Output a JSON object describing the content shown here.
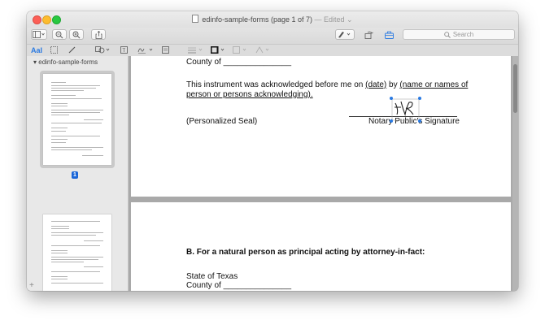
{
  "window": {
    "title": "edinfo-sample-forms (page 1 of 7)",
    "edited": "— Edited ⌄"
  },
  "toolbar": {
    "search_placeholder": "Search"
  },
  "markup": {
    "text_tool": "AaI"
  },
  "sidebar": {
    "title": "edinfo-sample-forms",
    "current_page_badge": "1"
  },
  "document": {
    "county_line_1": "County of _______________",
    "ack_line_1_pre": "This instrument was acknowledged before me on ",
    "ack_date": "(date)",
    "ack_by": " by ",
    "ack_name": "(name or names of",
    "ack_line_2": "person or persons acknowledging).",
    "seal": "(Personalized Seal)",
    "notary_signature": "Notary Public's Signature",
    "section_b_heading": "B. For a natural person as principal acting by attorney-in-fact:",
    "state_line": "State of Texas",
    "county_line_2": "County of _______________"
  },
  "colors": {
    "accent": "#2a7ae2",
    "badge": "#1a66d8"
  }
}
